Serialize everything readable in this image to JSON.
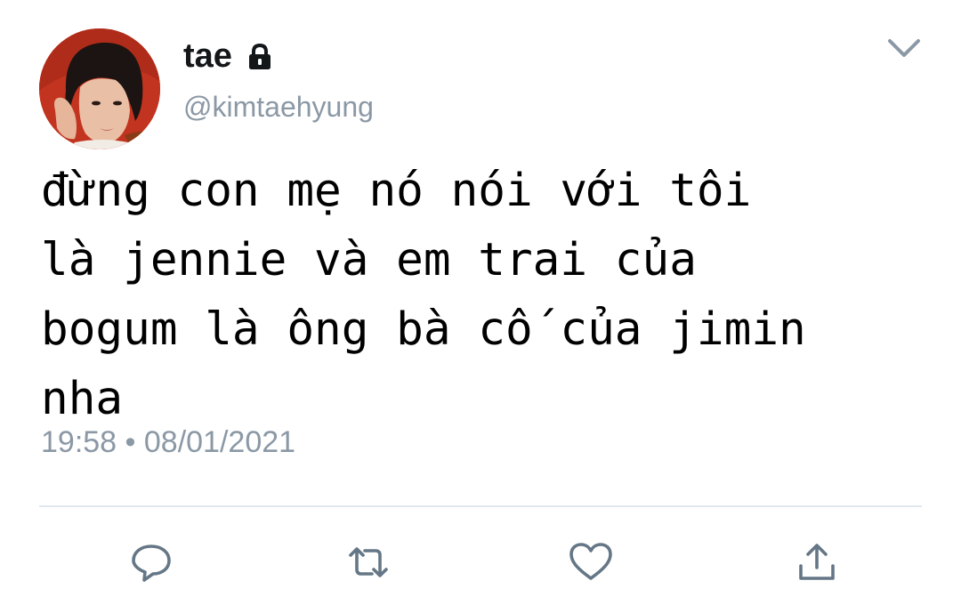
{
  "tweet": {
    "display_name": "tae",
    "handle": "@kimtaehyung",
    "text_lines": [
      "đừng con mẹ nó nói với tôi",
      "là jennie và em trai của",
      "bogum là ông bà cố của jimin",
      "nha"
    ],
    "timestamp": "19:58 • 08/01/2021"
  },
  "icons": {
    "avatar": "profile-photo",
    "lock": "lock-icon",
    "menu": "chevron-down-icon",
    "reply": "reply-icon",
    "retweet": "retweet-icon",
    "like": "heart-icon",
    "share": "share-icon"
  },
  "colors": {
    "text": "#14171a",
    "secondary": "#8b98a5",
    "icon": "#657786",
    "divider": "#e1e8ed",
    "avatar_background": "#c2341f"
  }
}
